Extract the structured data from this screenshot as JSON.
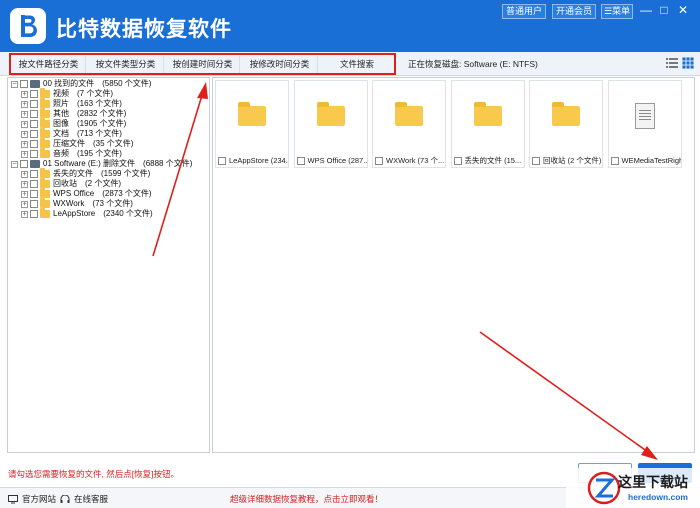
{
  "app": {
    "title": "比特数据恢复软件",
    "accent": "#1a6fd6",
    "top_buttons": [
      "普通用户",
      "开通会员",
      "菜单"
    ],
    "window_controls": [
      "—",
      "□",
      "✕"
    ]
  },
  "tabs": [
    "按文件路径分类",
    "按文件类型分类",
    "按创建时间分类",
    "按修改时间分类",
    "文件搜索"
  ],
  "disk_status": "正在恢复磁盘: Software (E: NTFS)",
  "tree": [
    {
      "level": 0,
      "expander": "−",
      "icon": "disk-icon",
      "name": "00 找到的文件",
      "count": "(5850 个文件)"
    },
    {
      "level": 1,
      "expander": "+",
      "icon": "folder-icon",
      "name": "视频",
      "count": "(7 个文件)"
    },
    {
      "level": 1,
      "expander": "+",
      "icon": "folder-icon",
      "name": "照片",
      "count": "(163 个文件)"
    },
    {
      "level": 1,
      "expander": "+",
      "icon": "folder-icon",
      "name": "其他",
      "count": "(2832 个文件)"
    },
    {
      "level": 1,
      "expander": "+",
      "icon": "folder-icon",
      "name": "图像",
      "count": "(1905 个文件)"
    },
    {
      "level": 1,
      "expander": "+",
      "icon": "folder-icon",
      "name": "文档",
      "count": "(713 个文件)"
    },
    {
      "level": 1,
      "expander": "+",
      "icon": "folder-icon",
      "name": "压缩文件",
      "count": "(35 个文件)"
    },
    {
      "level": 1,
      "expander": "+",
      "icon": "folder-icon",
      "name": "音频",
      "count": "(195 个文件)"
    },
    {
      "level": 0,
      "expander": "−",
      "icon": "disk-icon",
      "name": "01 Software (E:) 删除文件",
      "count": "(6888 个文件)"
    },
    {
      "level": 1,
      "expander": "+",
      "icon": "folder-icon",
      "name": "丢失的文件",
      "count": "(1599 个文件)"
    },
    {
      "level": 1,
      "expander": "+",
      "icon": "folder-icon",
      "name": "回收站",
      "count": "(2 个文件)"
    },
    {
      "level": 1,
      "expander": "+",
      "icon": "folder-icon",
      "name": "WPS Office",
      "count": "(2873 个文件)"
    },
    {
      "level": 1,
      "expander": "+",
      "icon": "folder-icon",
      "name": "WXWork",
      "count": "(73 个文件)"
    },
    {
      "level": 1,
      "expander": "+",
      "icon": "folder-icon",
      "name": "LeAppStore",
      "count": "(2340 个文件)"
    }
  ],
  "tiles": [
    {
      "icon": "folder-icon",
      "caption": "LeAppStore (234..."
    },
    {
      "icon": "folder-icon",
      "caption": "WPS Office (287..."
    },
    {
      "icon": "folder-icon",
      "caption": "WXWork (73 个..."
    },
    {
      "icon": "folder-icon",
      "caption": "丢失的文件 (15..."
    },
    {
      "icon": "folder-icon",
      "caption": "回收站 (2 个文件)"
    },
    {
      "icon": "document-icon",
      "caption": "WEMediaTestRigh..."
    }
  ],
  "hint": "请勾选您需要恢复的文件, 然后点[恢复]按钮。",
  "footer": {
    "website": "官方网站",
    "support": "在线客服",
    "tutorial": "超级详细数据恢复教程，点击立即观看！"
  },
  "watermark": {
    "cn": "这里下载站",
    "en": "heredown.com"
  }
}
